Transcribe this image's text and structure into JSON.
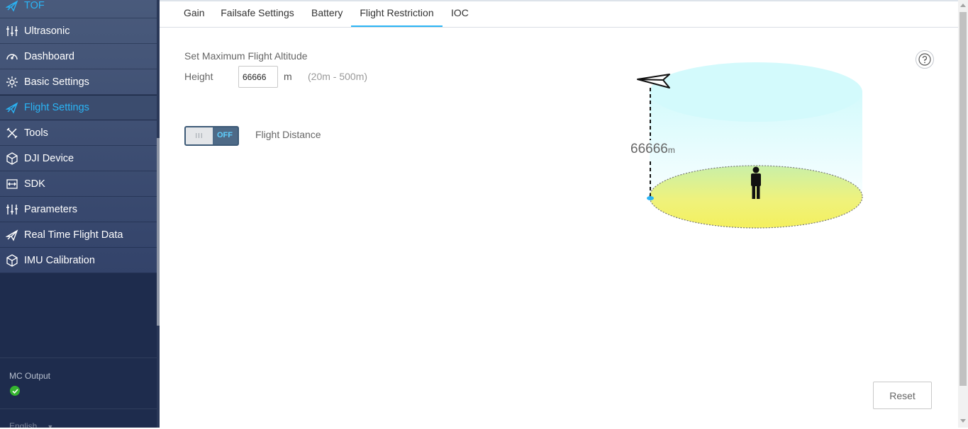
{
  "sidebar": {
    "items": [
      {
        "label": "TOF",
        "icon": "plane-icon",
        "active": false
      },
      {
        "label": "Ultrasonic",
        "icon": "sliders-icon",
        "active": false
      },
      {
        "label": "Dashboard",
        "icon": "gauge-icon",
        "active": false
      },
      {
        "label": "Basic Settings",
        "icon": "gear-icon",
        "active": false
      },
      {
        "label": "Flight Settings",
        "icon": "plane-icon",
        "active": true
      },
      {
        "label": "Tools",
        "icon": "tools-icon",
        "active": false
      },
      {
        "label": "DJI Device",
        "icon": "cube-icon",
        "active": false
      },
      {
        "label": "SDK",
        "icon": "sdk-icon",
        "active": false
      },
      {
        "label": "Parameters",
        "icon": "sliders-icon",
        "active": false
      },
      {
        "label": "Real Time Flight Data",
        "icon": "plane-icon",
        "active": false
      },
      {
        "label": "IMU Calibration",
        "icon": "cube-icon",
        "active": false
      }
    ],
    "mc_output": {
      "label": "MC Output",
      "status_color": "#35b52f"
    },
    "language": "English"
  },
  "tabs": [
    {
      "label": "Gain"
    },
    {
      "label": "Failsafe Settings"
    },
    {
      "label": "Battery"
    },
    {
      "label": "Flight Restriction",
      "active": true
    },
    {
      "label": "IOC"
    }
  ],
  "altitude": {
    "title": "Set Maximum Flight Altitude",
    "height_label": "Height",
    "value": "66666",
    "unit": "m",
    "range_hint": "(20m - 500m)"
  },
  "flight_distance": {
    "toggle_state": "OFF",
    "label": "Flight Distance"
  },
  "illustration": {
    "altitude_value": "66666",
    "altitude_unit": "m"
  },
  "reset_label": "Reset",
  "colors": {
    "accent": "#2ab4f5",
    "sidebar_bg": "#1e2c4d"
  }
}
